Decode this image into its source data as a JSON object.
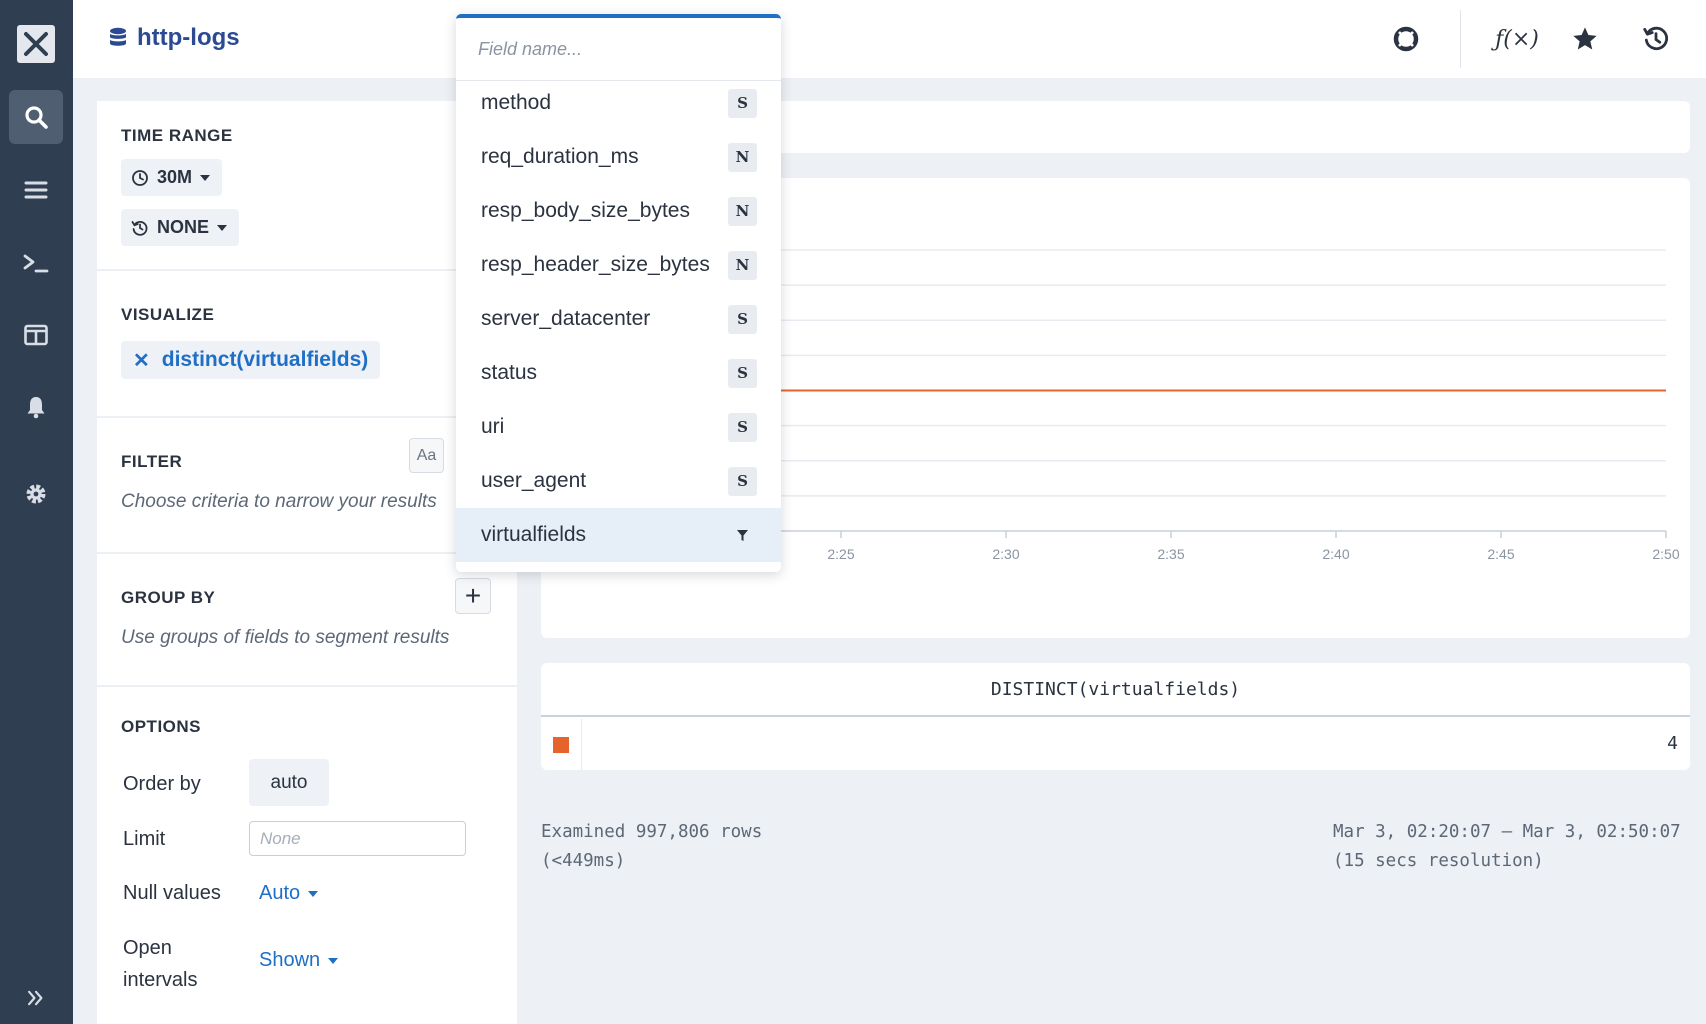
{
  "header": {
    "dataset_name": "http-logs"
  },
  "query": {
    "time_range": {
      "title": "TIME RANGE",
      "range_value": "30M",
      "compare_value": "NONE"
    },
    "visualize": {
      "title": "VISUALIZE",
      "items": [
        "distinct(virtualfields)"
      ]
    },
    "filter": {
      "title": "FILTER",
      "case_toggle": "Aa",
      "hint": "Choose criteria to narrow your results"
    },
    "group_by": {
      "title": "GROUP BY",
      "add_label": "+",
      "hint": "Use groups of fields to segment results"
    },
    "options": {
      "title": "OPTIONS",
      "order_by_label": "Order by",
      "order_by_value": "auto",
      "limit_label": "Limit",
      "limit_placeholder": "None",
      "null_values_label": "Null values",
      "null_values_value": "Auto",
      "open_intervals_label": "Open intervals",
      "open_intervals_value": "Shown"
    }
  },
  "field_dropdown": {
    "placeholder": "Field name...",
    "items": [
      {
        "label": "method",
        "type": "S"
      },
      {
        "label": "req_duration_ms",
        "type": "N"
      },
      {
        "label": "resp_body_size_bytes",
        "type": "N"
      },
      {
        "label": "resp_header_size_bytes",
        "type": "N"
      },
      {
        "label": "server_datacenter",
        "type": "S"
      },
      {
        "label": "status",
        "type": "S"
      },
      {
        "label": "uri",
        "type": "S"
      },
      {
        "label": "user_agent",
        "type": "S"
      },
      {
        "label": "virtualfields",
        "type": "filter-icon",
        "selected": true
      }
    ]
  },
  "chart_data": {
    "type": "line",
    "x_tick_labels": [
      "2:25",
      "2:30",
      "2:35",
      "2:40",
      "2:45",
      "2:50"
    ],
    "series": [
      {
        "name": "DISTINCT(virtualfields)",
        "color": "#e4642c",
        "values": [
          4,
          4,
          4,
          4,
          4,
          4,
          4
        ]
      }
    ],
    "grid": true
  },
  "results_table": {
    "column_header": "DISTINCT(virtualfields)",
    "rows": [
      {
        "swatch_color": "#e4642c",
        "value": "4"
      }
    ]
  },
  "footer": {
    "examined_line1": "Examined 997,806 rows",
    "examined_line2": "(<449ms)",
    "range_line1": "Mar 3, 02:20:07 – Mar 3, 02:50:07",
    "range_line2": "(15 secs resolution)"
  },
  "icons": {
    "rail": [
      "close-logo-icon",
      "search-icon",
      "list-icon",
      "terminal-icon",
      "board-icon",
      "bell-icon",
      "gear-icon",
      "expand-icon"
    ],
    "topbar": [
      "database-icon",
      "help-icon",
      "function-icon",
      "star-icon",
      "history-icon"
    ]
  },
  "colors": {
    "accent": "#1f6fc7",
    "series": "#e4642c",
    "rail": "#2f3e51"
  }
}
